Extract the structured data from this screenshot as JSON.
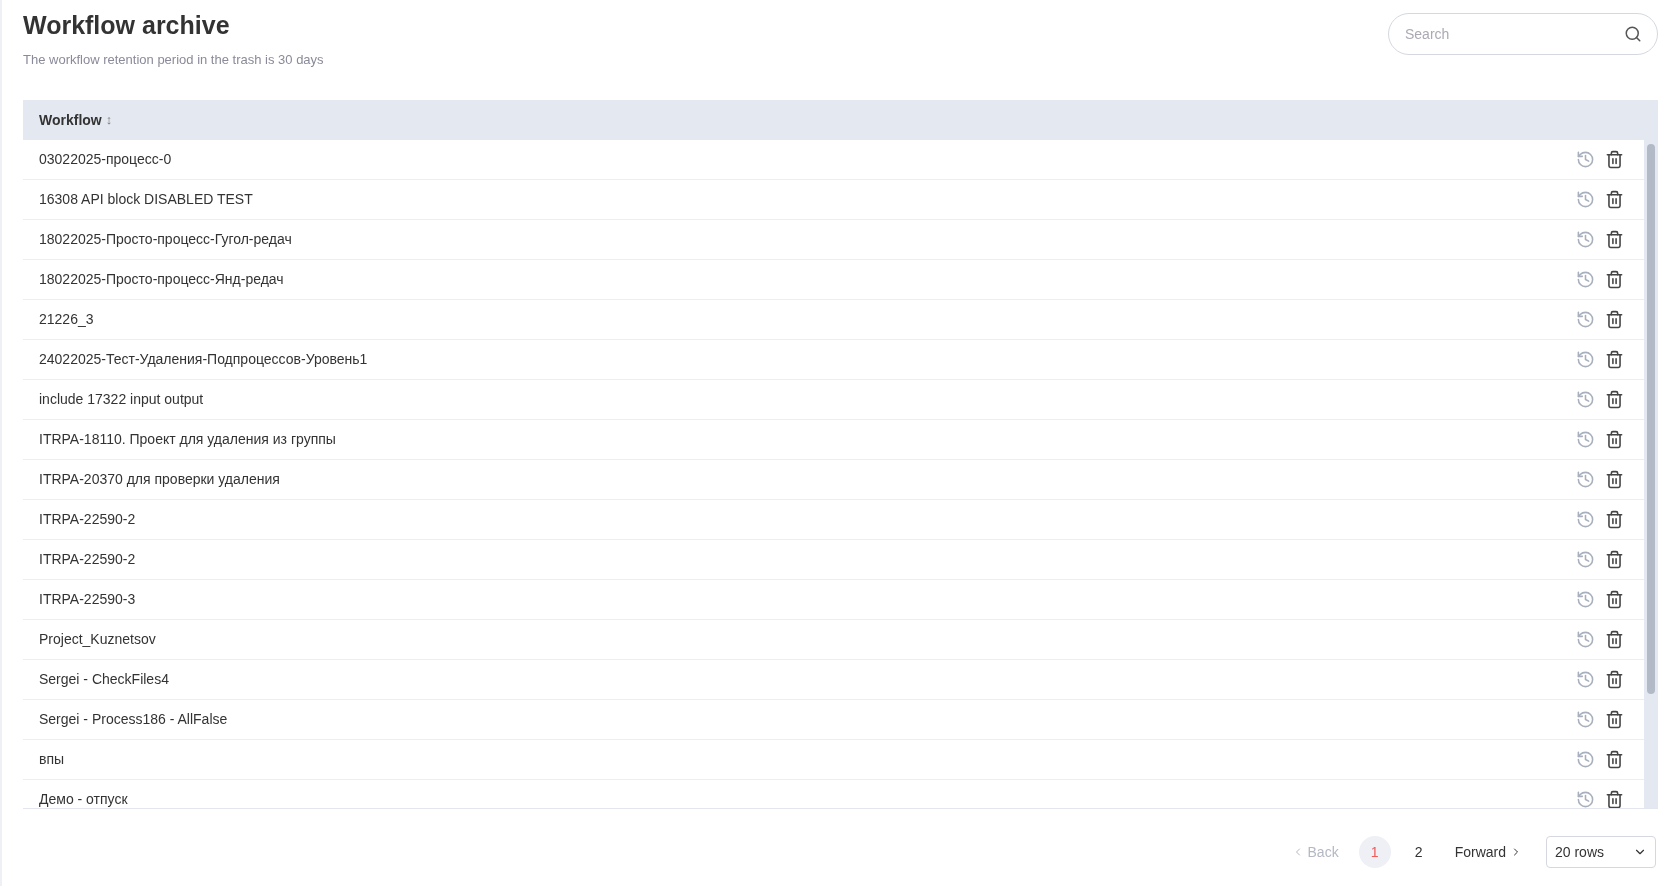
{
  "header": {
    "title": "Workflow archive",
    "subtitle": "The workflow retention period in the trash is 30 days"
  },
  "search": {
    "placeholder": "Search"
  },
  "table": {
    "columns": [
      {
        "label": "Workflow",
        "sort_icon": "↕"
      }
    ],
    "rows": [
      {
        "name": "03022025-процесс-0"
      },
      {
        "name": "16308 API block DISABLED TEST"
      },
      {
        "name": "18022025-Просто-процесс-Гугол-редач"
      },
      {
        "name": "18022025-Просто-процесс-Янд-редач"
      },
      {
        "name": "21226_3"
      },
      {
        "name": "24022025-Тест-Удаления-Подпроцессов-Уровень1"
      },
      {
        "name": "include 17322 input output"
      },
      {
        "name": "ITRPA-18110. Проект для удаления из группы"
      },
      {
        "name": "ITRPA-20370 для проверки удаления"
      },
      {
        "name": "ITRPA-22590-2"
      },
      {
        "name": "ITRPA-22590-2"
      },
      {
        "name": "ITRPA-22590-3"
      },
      {
        "name": "Project_Kuznetsov"
      },
      {
        "name": "Sergei - CheckFiles4"
      },
      {
        "name": "Sergei - Process186 - AllFalse"
      },
      {
        "name": "впы"
      },
      {
        "name": "Демо - отпуск"
      }
    ]
  },
  "pagination": {
    "back": {
      "label": "Back",
      "disabled": true
    },
    "pages": [
      {
        "label": "1",
        "selected": true
      },
      {
        "label": "2",
        "selected": false
      }
    ],
    "forward": {
      "label": "Forward",
      "disabled": false
    },
    "page_size": "20 rows"
  }
}
